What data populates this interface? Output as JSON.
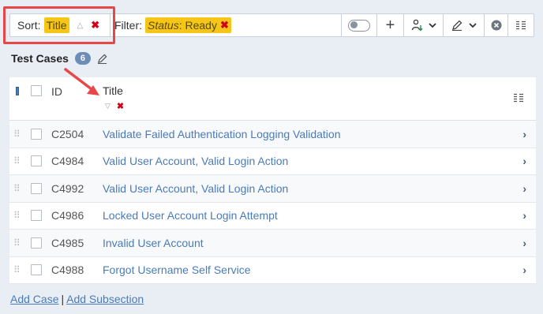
{
  "toolbar": {
    "sort_label": "Sort:",
    "sort_value": "Title",
    "sort_direction_icon": "triangle-up-icon",
    "sort_clear_glyph": "✖",
    "filter_label": "Filter:",
    "filter_key": "Status",
    "filter_colon": ":",
    "filter_value": "Ready",
    "filter_clear_glyph": "✖",
    "add_glyph": "+",
    "assign_glyph": "⇩",
    "edit_glyph": "✎",
    "dropdown_glyph": "⌄",
    "clear_glyph": "⊗",
    "columns_glyph": "☷"
  },
  "section": {
    "title": "Test Cases",
    "count": "6",
    "edit_glyph": "✎"
  },
  "table": {
    "columns": {
      "id": "ID",
      "title": "Title"
    },
    "rows": [
      {
        "id": "C2504",
        "title": "Validate Failed Authentication Logging Validation"
      },
      {
        "id": "C4984",
        "title": "Valid User Account, Valid Login Action"
      },
      {
        "id": "C4992",
        "title": "Valid User Account, Valid Login Action"
      },
      {
        "id": "C4986",
        "title": "Locked User Account Login Attempt"
      },
      {
        "id": "C4985",
        "title": "Invalid User Account"
      },
      {
        "id": "C4988",
        "title": "Forgot Username Self Service"
      }
    ],
    "chevron_glyph": "›",
    "drag_glyph": "⠿",
    "sort_down_glyph": "▽",
    "sort_clear_glyph": "✖",
    "columns_glyph": "☷"
  },
  "footer": {
    "add_case": "Add Case",
    "separator": "|",
    "add_subsection": "Add Subsection"
  },
  "colors": {
    "accent": "#4a7bb7",
    "tag": "#f5c518",
    "highlight": "#e8474a",
    "clear": "#d0021b"
  }
}
